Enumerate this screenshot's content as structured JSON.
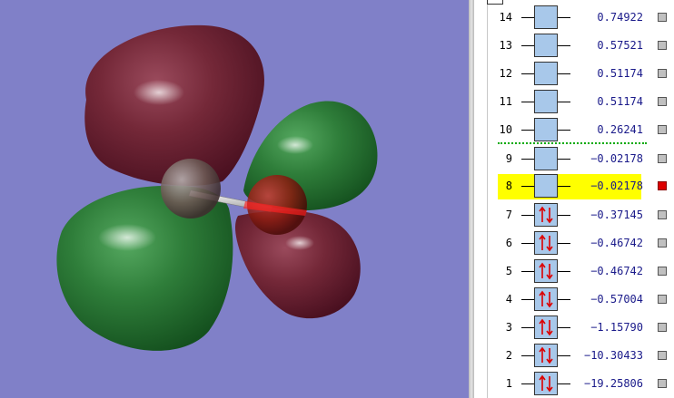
{
  "orbitals": [
    {
      "number": "14",
      "energy": "0.74922",
      "occupied": false,
      "selected": false
    },
    {
      "number": "13",
      "energy": "0.57521",
      "occupied": false,
      "selected": false
    },
    {
      "number": "12",
      "energy": "0.51174",
      "occupied": false,
      "selected": false
    },
    {
      "number": "11",
      "energy": "0.51174",
      "occupied": false,
      "selected": false
    },
    {
      "number": "10",
      "energy": "0.26241",
      "occupied": false,
      "selected": false
    },
    {
      "number": "9",
      "energy": "−0.02178",
      "occupied": false,
      "selected": false
    },
    {
      "number": "8",
      "energy": "−0.02178",
      "occupied": false,
      "selected": true
    },
    {
      "number": "7",
      "energy": "−0.37145",
      "occupied": true,
      "selected": false
    },
    {
      "number": "6",
      "energy": "−0.46742",
      "occupied": true,
      "selected": false
    },
    {
      "number": "5",
      "energy": "−0.46742",
      "occupied": true,
      "selected": false
    },
    {
      "number": "4",
      "energy": "−0.57004",
      "occupied": true,
      "selected": false
    },
    {
      "number": "3",
      "energy": "−1.15790",
      "occupied": true,
      "selected": false
    },
    {
      "number": "2",
      "energy": "−10.30433",
      "occupied": true,
      "selected": false
    },
    {
      "number": "1",
      "energy": "−19.25806",
      "occupied": true,
      "selected": false
    }
  ],
  "colors": {
    "viewer_background": "#8080c8",
    "positive_lobe": "#2f7a3a",
    "negative_lobe": "#6e2436",
    "highlight": "#ffff00",
    "energy_text": "#1a1a8a",
    "orbital_box": "#a8c8ea",
    "selected_marker": "#dd0000",
    "homo_lumo_divider": "#00aa00"
  },
  "icons": {
    "occupied": "spin-pair-arrows-icon",
    "unselected": "gray-square-icon",
    "selected": "red-square-icon"
  }
}
